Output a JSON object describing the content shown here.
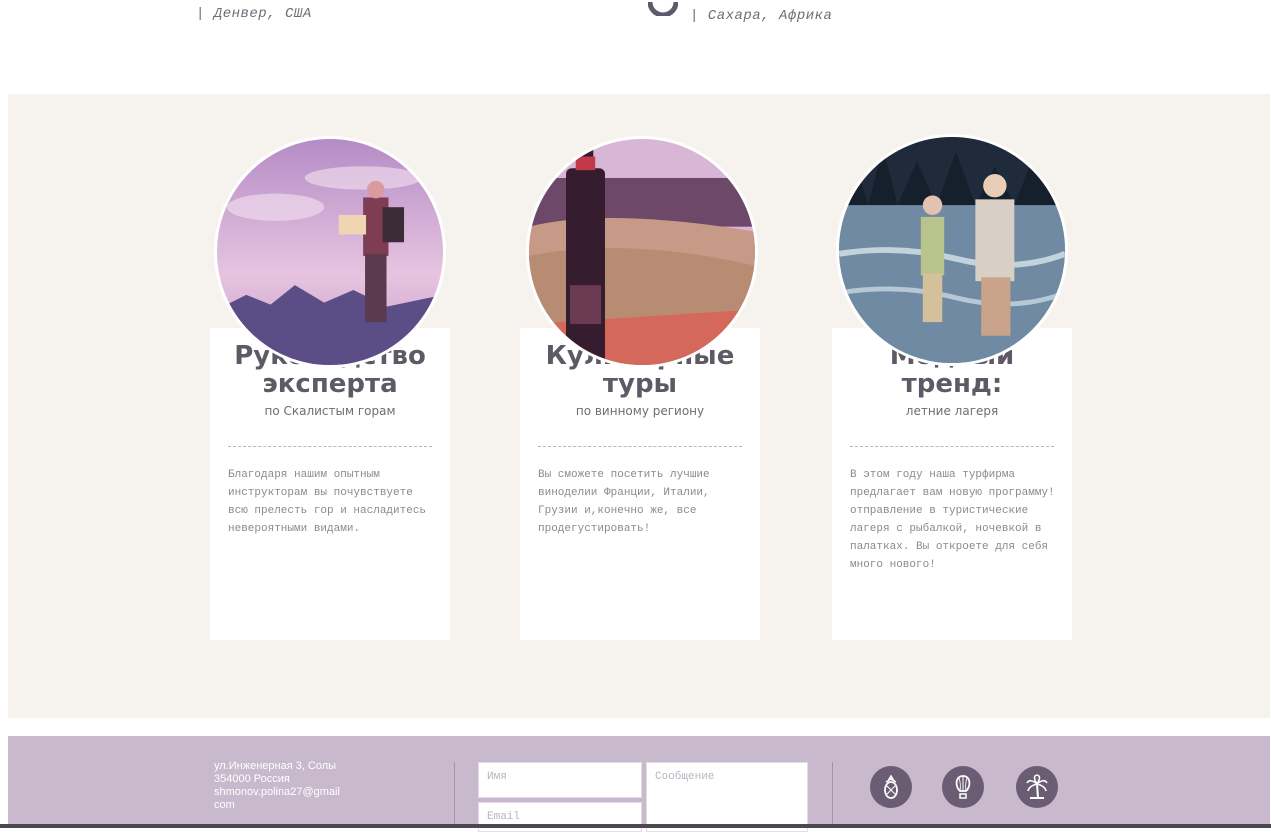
{
  "top": {
    "left_location": "| Денвер, США",
    "right_location": "| Сахара, Африка"
  },
  "cards": [
    {
      "title_line1": "Руководство",
      "title_line2": "эксперта",
      "subtitle": "по Скалистым горам",
      "text": "Благодаря нашим опытным инструкторам вы почувствуете всю прелесть гор и насладитесь невероятными видами."
    },
    {
      "title_line1": "Кулинарные",
      "title_line2": "туры",
      "subtitle": "по винному региону",
      "text": "Вы сможете посетить лучшие виноделии Франции, Италии, Грузии и,конечно же, все продегустировать!"
    },
    {
      "title_line1": "Модный",
      "title_line2": "тренд:",
      "subtitle": "летние лагеря",
      "text": "В этом году наша турфирма предлагает вам новую программу! отправление в туристические лагеря с рыбалкой, ночевкой в палатках. Вы откроете для себя много нового!"
    }
  ],
  "footer": {
    "address_line1": "ул.Инженерная 3, Солы",
    "address_line2": "354000 Россия",
    "address_line3": "shmonov.polina27@gmail",
    "address_line4": "com",
    "name_placeholder": "Имя",
    "email_placeholder": "Email",
    "message_placeholder": "Сообщение",
    "icons": [
      "pineapple-icon",
      "hot-air-balloon-icon",
      "palm-tree-icon"
    ]
  }
}
